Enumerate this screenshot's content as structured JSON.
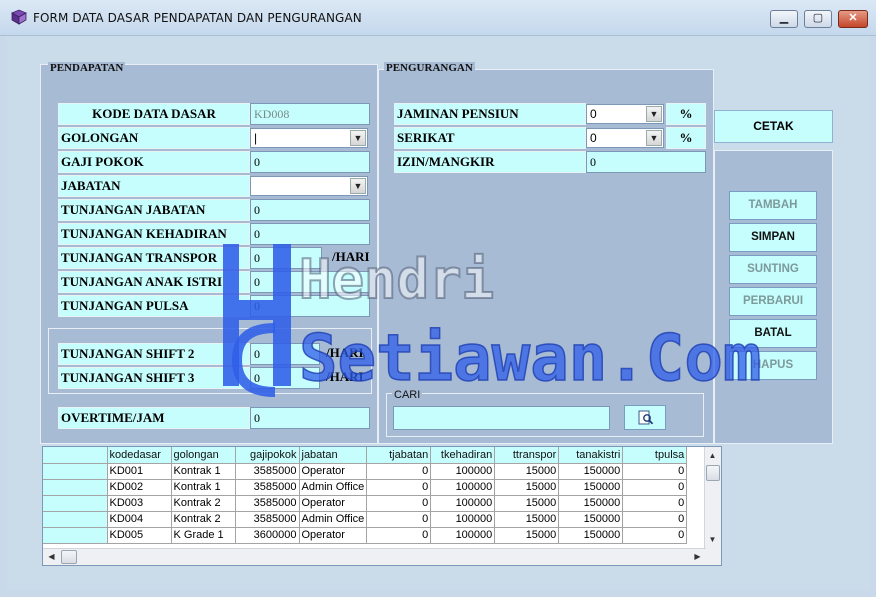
{
  "window": {
    "title": "FORM DATA DASAR PENDAPATAN DAN PENGURANGAN",
    "minimize": "▁",
    "maximize": "▢",
    "close": "✕"
  },
  "pendapatan": {
    "title": "PENDAPATAN",
    "kode_label": "KODE DATA DASAR",
    "kode_value": "KD008",
    "golongan_label": "GOLONGAN",
    "golongan_value": "|",
    "gaji_label": "GAJI POKOK",
    "gaji_value": "0",
    "jabatan_label": "JABATAN",
    "jabatan_value": "",
    "tj_jabatan_label": "TUNJANGAN JABATAN",
    "tj_jabatan_value": "0",
    "tj_kehadiran_label": "TUNJANGAN KEHADIRAN",
    "tj_kehadiran_value": "0",
    "tj_transpor_label": "TUNJANGAN TRANSPOR",
    "tj_transpor_value": "0",
    "tj_transpor_unit": "/HARI",
    "tj_anak_label": "TUNJANGAN ANAK ISTRI",
    "tj_anak_value": "0",
    "tj_pulsa_label": "TUNJANGAN PULSA",
    "tj_pulsa_value": "0",
    "shift2_label": "TUNJANGAN SHIFT 2",
    "shift2_value": "0",
    "shift2_unit": "/HARI",
    "shift3_label": "TUNJANGAN SHIFT 3",
    "shift3_value": "0",
    "shift3_unit": "/HARI",
    "overtime_label": "OVERTIME/JAM",
    "overtime_value": "0"
  },
  "pengurangan": {
    "title": "PENGURANGAN",
    "pensiun_label": "JAMINAN PENSIUN",
    "pensiun_value": "0",
    "pensiun_unit": "%",
    "serikat_label": "SERIKAT",
    "serikat_value": "0",
    "serikat_unit": "%",
    "izin_label": "IZIN/MANGKIR",
    "izin_value": "0"
  },
  "cari": {
    "title": "CARI",
    "value": ""
  },
  "buttons": {
    "cetak": "CETAK",
    "tambah": "TAMBAH",
    "simpan": "SIMPAN",
    "sunting": "SUNTING",
    "perbarui": "PERBARUI",
    "batal": "BATAL",
    "hapus": "HAPUS"
  },
  "watermark": {
    "line1": "Hendri",
    "line2": "Setiawan.Com"
  },
  "table": {
    "columns": [
      "kodedasar",
      "golongan",
      "gajipokok",
      "jabatan",
      "tjabatan",
      "tkehadiran",
      "ttranspor",
      "tanakistri",
      "tpulsa"
    ],
    "rows": [
      [
        "KD001",
        "Kontrak 1",
        "3585000",
        "Operator",
        "0",
        "100000",
        "15000",
        "150000",
        "0"
      ],
      [
        "KD002",
        "Kontrak 1",
        "3585000",
        "Admin Office",
        "0",
        "100000",
        "15000",
        "150000",
        "0"
      ],
      [
        "KD003",
        "Kontrak 2",
        "3585000",
        "Operator",
        "0",
        "100000",
        "15000",
        "150000",
        "0"
      ],
      [
        "KD004",
        "Kontrak 2",
        "3585000",
        "Admin Office",
        "0",
        "100000",
        "15000",
        "150000",
        "0"
      ],
      [
        "KD005",
        "K Grade 1",
        "3600000",
        "Operator",
        "0",
        "100000",
        "15000",
        "150000",
        "0"
      ]
    ]
  },
  "colors": {
    "accent": "#c6fdfd",
    "panel": "#a8bbd4",
    "background": "#cadbea"
  }
}
